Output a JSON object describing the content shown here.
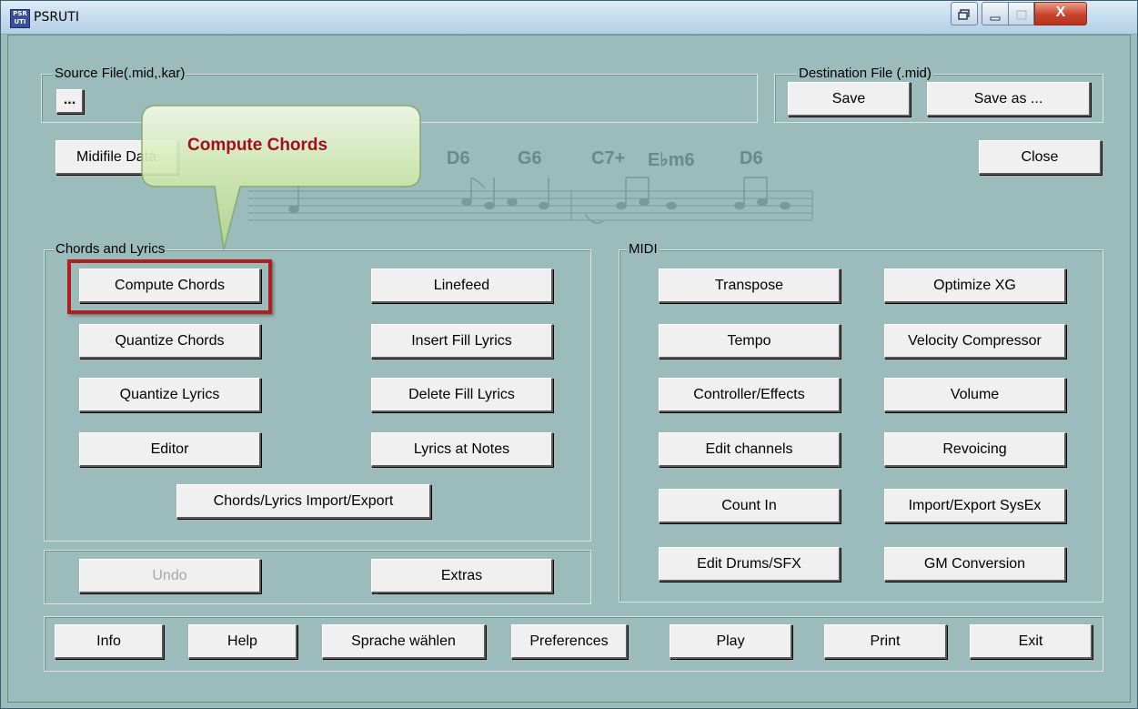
{
  "window": {
    "title": "PSRUTI",
    "app_icon_text": [
      "PSR",
      "UTI"
    ]
  },
  "titlebar_buttons": {
    "restore_icon": "restore-icon",
    "minimize_icon": "minimize-icon",
    "maximize_icon": "maximize-icon",
    "close_icon": "close-icon",
    "close_glyph": "X"
  },
  "source": {
    "legend": "Source File(.mid,.kar)",
    "browse_label": "..."
  },
  "destination": {
    "legend": "Destination File (.mid)",
    "save_label": "Save",
    "save_as_label": "Save as ..."
  },
  "top_buttons": {
    "midifile_data_label": "Midifile Data",
    "close_label": "Close"
  },
  "score_chords": [
    "D6",
    "G6",
    "C7+",
    "E♭m6",
    "D6"
  ],
  "tooltip": {
    "text": "Compute Chords"
  },
  "chords_lyrics": {
    "legend": "Chords and Lyrics",
    "compute_chords": "Compute Chords",
    "linefeed": "Linefeed",
    "quantize_chords": "Quantize Chords",
    "insert_fill_lyrics": "Insert Fill Lyrics",
    "quantize_lyrics": "Quantize Lyrics",
    "delete_fill_lyrics": "Delete Fill Lyrics",
    "editor": "Editor",
    "lyrics_at_notes": "Lyrics at Notes",
    "import_export": "Chords/Lyrics Import/Export"
  },
  "undo_group": {
    "undo": "Undo",
    "extras": "Extras"
  },
  "midi": {
    "legend": "MIDI",
    "transpose": "Transpose",
    "optimize_xg": "Optimize XG",
    "tempo": "Tempo",
    "velocity_compressor": "Velocity Compressor",
    "controller_effects": "Controller/Effects",
    "volume": "Volume",
    "edit_channels": "Edit channels",
    "revoicing": "Revoicing",
    "count_in": "Count In",
    "import_export_sysex": "Import/Export SysEx",
    "edit_drums_sfx": "Edit Drums/SFX",
    "gm_conversion": "GM Conversion"
  },
  "bottom_bar": {
    "info": "Info",
    "help": "Help",
    "language": "Sprache wählen",
    "preferences": "Preferences",
    "play": "Play",
    "print": "Print",
    "exit": "Exit"
  },
  "colors": {
    "window_bg": "#9cbcbc",
    "highlight_border": "#b31d1d",
    "tooltip_text": "#a0101c",
    "tooltip_bg": "#c8e4a8"
  }
}
